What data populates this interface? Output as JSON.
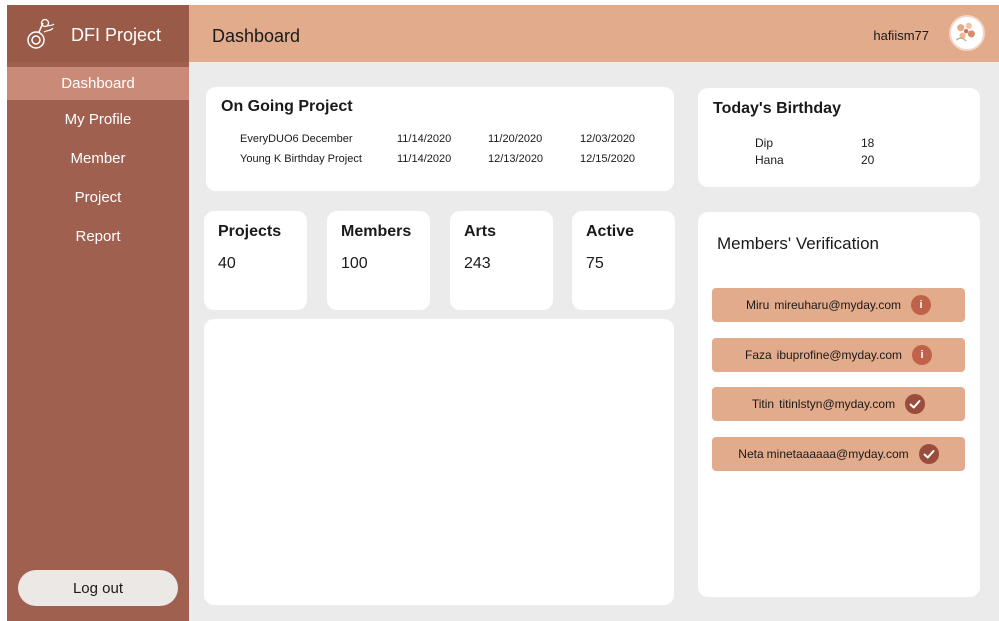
{
  "app": {
    "title": "DFI Project",
    "colors": {
      "sidebar": "#a0604f",
      "sidebar_active": "#c98a78",
      "header": "#e2ab8b",
      "main_bg": "#ebebeb",
      "verify_item": "#e2ab8b",
      "info_badge": "#c0624a",
      "check_badge": "#9a4d3c"
    }
  },
  "sidebar": {
    "logo_icon": "plant-pot-icon",
    "items": [
      {
        "label": "Dashboard",
        "active": true
      },
      {
        "label": "My Profile",
        "active": false
      },
      {
        "label": "Member",
        "active": false
      },
      {
        "label": "Project",
        "active": false
      },
      {
        "label": "Report",
        "active": false
      }
    ],
    "logout_label": "Log out"
  },
  "header": {
    "title": "Dashboard",
    "username": "hafiism77",
    "avatar_icon": "flower-avatar-icon"
  },
  "ongoing": {
    "title": "On Going Project",
    "rows": [
      {
        "name": "EveryDUO6 December",
        "d1": "11/14/2020",
        "d2": "11/20/2020",
        "d3": "12/03/2020"
      },
      {
        "name": "Young K Birthday Project",
        "d1": "11/14/2020",
        "d2": "12/13/2020",
        "d3": "12/15/2020"
      }
    ]
  },
  "birthday": {
    "title": "Today's Birthday",
    "rows": [
      {
        "name": "Dip",
        "age": "18"
      },
      {
        "name": "Hana",
        "age": "20"
      }
    ]
  },
  "stats": [
    {
      "label": "Projects",
      "value": "40"
    },
    {
      "label": "Members",
      "value": "100"
    },
    {
      "label": "Arts",
      "value": "243"
    },
    {
      "label": "Active",
      "value": "75"
    }
  ],
  "verification": {
    "title": "Members' Verification",
    "items": [
      {
        "name": "Miru",
        "email": "mireuharu@myday.com",
        "status_icon": "info-icon",
        "status_text": "i"
      },
      {
        "name": "Faza",
        "email": "ibuprofine@myday.com",
        "status_icon": "info-icon",
        "status_text": "i"
      },
      {
        "name": "Titin",
        "email": "titinlstyn@myday.com",
        "status_icon": "check-icon",
        "status_text": ""
      },
      {
        "name": "Neta",
        "email": "minetaaaaaa@myday.com",
        "status_icon": "check-icon",
        "status_text": ""
      }
    ]
  }
}
